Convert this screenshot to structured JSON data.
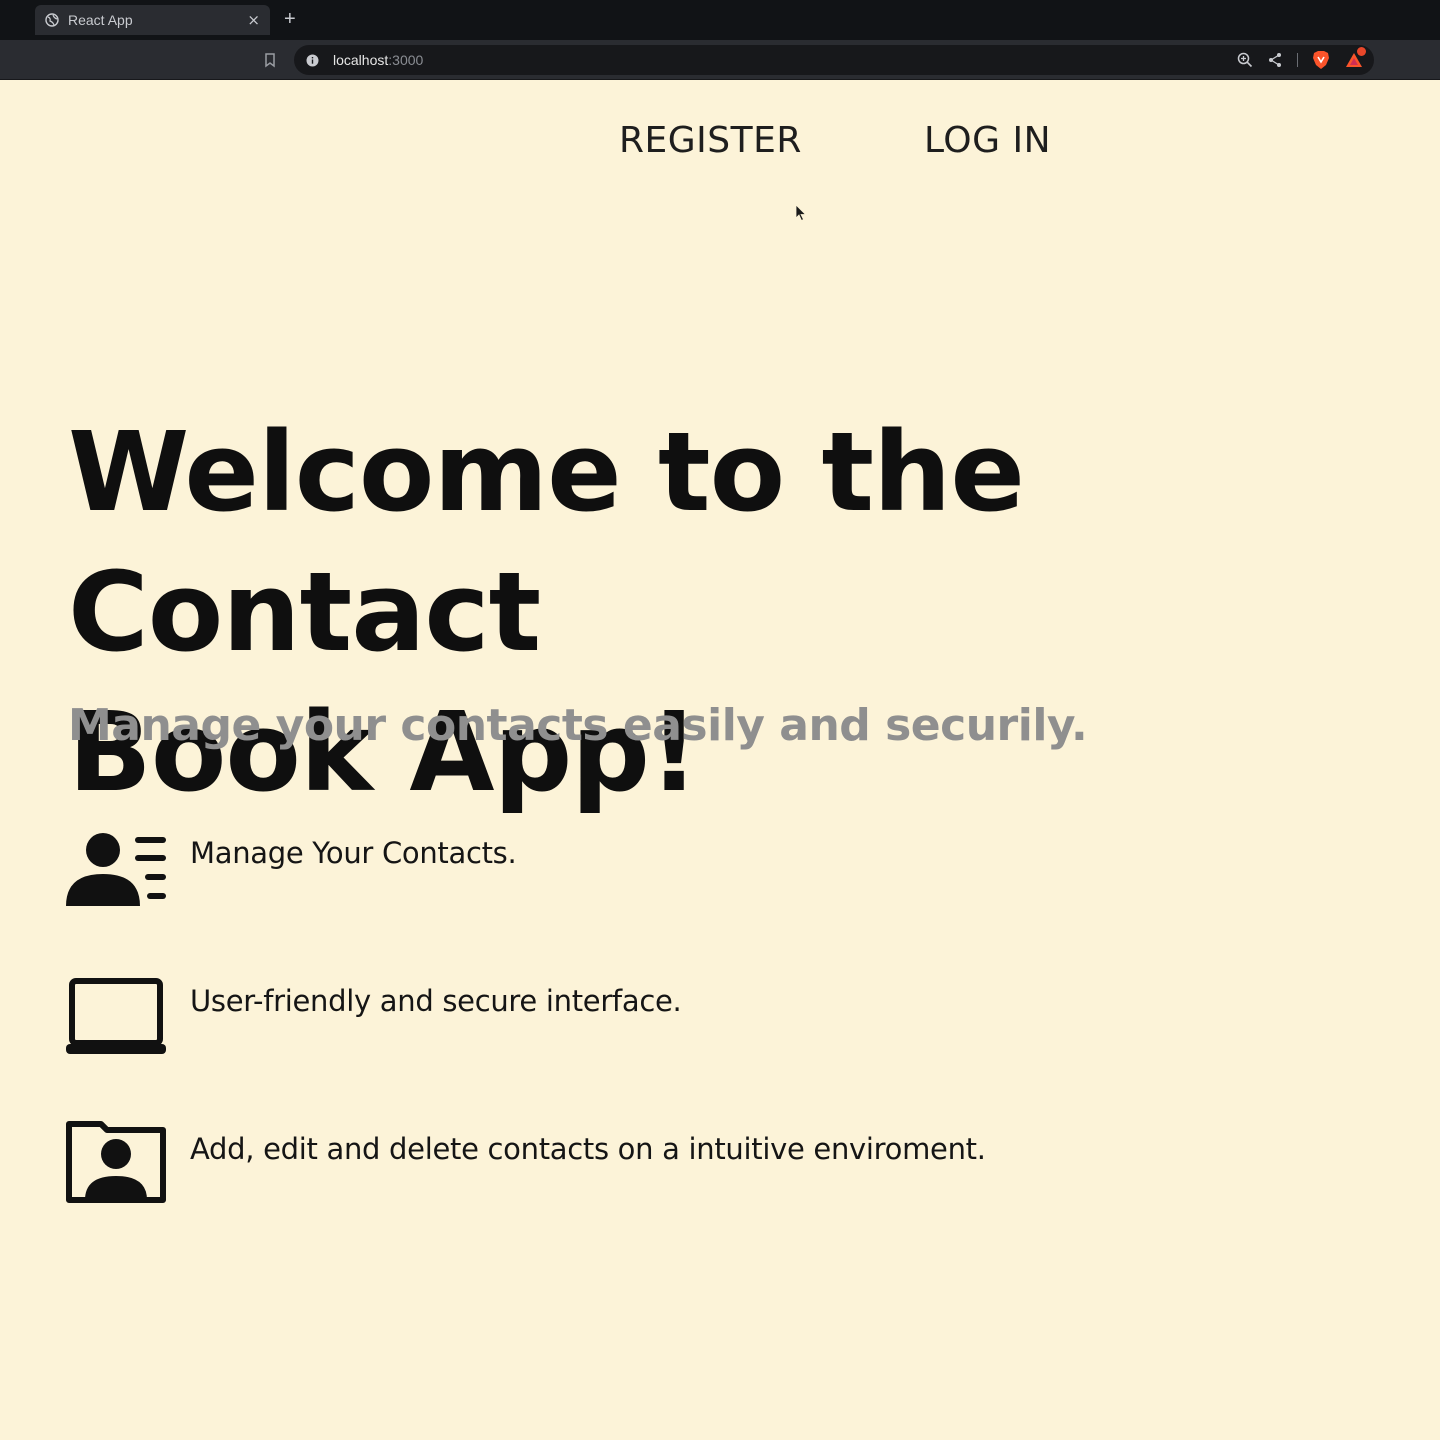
{
  "browser": {
    "tab_title": "React App",
    "tab_close": "×",
    "new_tab": "+",
    "url_host": "localhost",
    "url_port": ":3000"
  },
  "nav": {
    "register": "REGISTER",
    "login": "LOG IN"
  },
  "hero": {
    "title": "Welcome to the Contact\nBook App!",
    "subtitle": "Manage your contacts easily and securily."
  },
  "features": [
    {
      "icon": "contacts-list-icon",
      "text": "Manage Your Contacts."
    },
    {
      "icon": "laptop-icon",
      "text": "User-friendly and secure interface."
    },
    {
      "icon": "contact-card-icon",
      "text": "Add, edit and delete contacts on a intuitive enviroment."
    }
  ],
  "colors": {
    "page_background": "#fcf3d8",
    "title": "#0f0f0f",
    "subtitle": "#8f8f8f",
    "browser_dark": "#111316",
    "brave_orange": "#fb542b"
  }
}
